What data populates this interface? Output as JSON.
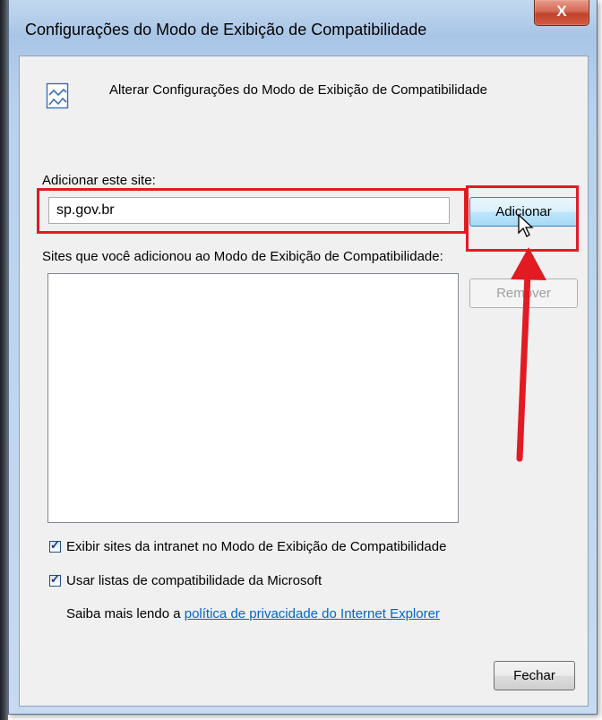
{
  "window": {
    "title": "Configurações do Modo de Exibição de Compatibilidade",
    "close_label": "X"
  },
  "header": {
    "icon": "compat-view-icon",
    "text": "Alterar Configurações do Modo de Exibição de Compatibilidade"
  },
  "add_site": {
    "label": "Adicionar este site:",
    "value": "sp.gov.br",
    "button_label": "Adicionar"
  },
  "sites_list": {
    "label": "Sites que você adicionou ao Modo de Exibição de Compatibilidade:",
    "items": [],
    "remove_label": "Remover"
  },
  "options": {
    "intranet_label": "Exibir sites da intranet no Modo de Exibição de Compatibilidade",
    "intranet_checked": true,
    "ms_lists_label": "Usar listas de compatibilidade da Microsoft",
    "ms_lists_checked": true
  },
  "privacy": {
    "prefix": "Saiba mais lendo a ",
    "link": "política de privacidade do Internet Explorer"
  },
  "footer": {
    "close_button_label": "Fechar"
  },
  "colors": {
    "highlight": "#e21b23",
    "link": "#0066cc"
  }
}
